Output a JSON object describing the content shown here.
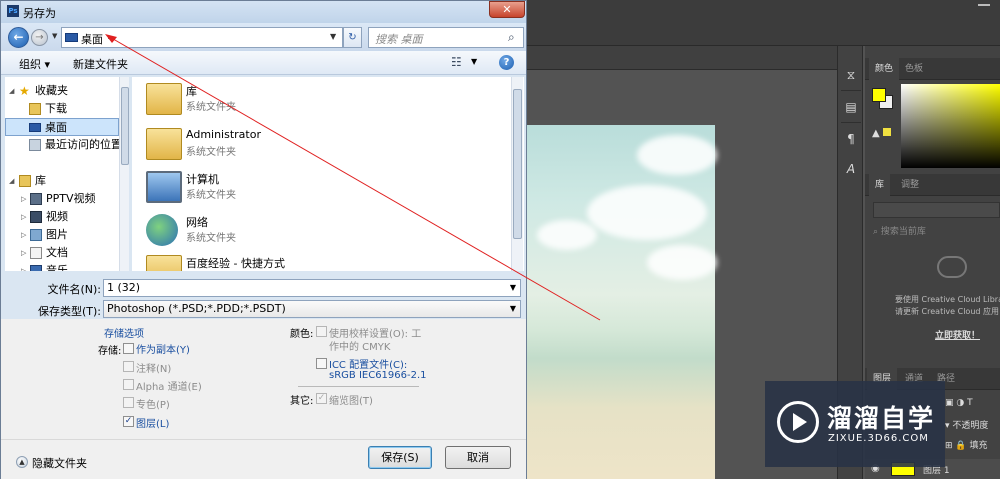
{
  "dialog": {
    "title": "另存为",
    "app_icon_label": "Ps",
    "close_label": "✕",
    "address": {
      "location": "桌面",
      "separator": "▸"
    },
    "search": {
      "placeholder": "搜索 桌面"
    },
    "toolbar": {
      "organize": "组织 ▾",
      "new_folder": "新建文件夹"
    },
    "nav": [
      {
        "label": "收藏夹",
        "icon": "star-icon",
        "expander": "◢"
      },
      {
        "label": "下载",
        "icon": "downloads-folder-icon",
        "expander": ""
      },
      {
        "label": "桌面",
        "icon": "desktop-icon",
        "expander": "",
        "selected": true
      },
      {
        "label": "最近访问的位置",
        "icon": "recent-places-icon",
        "expander": ""
      },
      {
        "label": "库",
        "icon": "library-icon",
        "expander": "◢"
      },
      {
        "label": "PPTV视频",
        "icon": "video-library-icon",
        "expander": "▷"
      },
      {
        "label": "视频",
        "icon": "video-library-icon",
        "expander": "▷"
      },
      {
        "label": "图片",
        "icon": "pictures-library-icon",
        "expander": "▷"
      },
      {
        "label": "文档",
        "icon": "documents-library-icon",
        "expander": "▷"
      },
      {
        "label": "音乐",
        "icon": "music-library-icon",
        "expander": "▷"
      }
    ],
    "files": [
      {
        "name": "库",
        "type": "系统文件夹",
        "icon": "library-folder-icon"
      },
      {
        "name": "Administrator",
        "type": "系统文件夹",
        "icon": "user-folder-icon"
      },
      {
        "name": "计算机",
        "type": "系统文件夹",
        "icon": "computer-icon"
      },
      {
        "name": "网络",
        "type": "系统文件夹",
        "icon": "network-icon"
      },
      {
        "name": "百度经验 - 快捷方式",
        "type": "",
        "icon": "folder-shortcut-icon"
      }
    ],
    "filename_label": "文件名(N):",
    "filename_value": "1 (32)",
    "filetype_label": "保存类型(T):",
    "filetype_value": "Photoshop (*.PSD;*.PDD;*.PSDT)",
    "options": {
      "title": "存储选项",
      "save_label": "存储:",
      "as_copy": "作为副本(Y)",
      "notes": "注释(N)",
      "alpha": "Alpha 通道(E)",
      "spot": "专色(P)",
      "layers": "图层(L)",
      "color_label": "颜色:",
      "proof_setup": "使用校样设置(O): 工",
      "proof_setup_2": "作中的 CMYK",
      "icc": "ICC 配置文件(C):",
      "icc_profile": "sRGB IEC61966-2.1",
      "other_label": "其它:",
      "thumbnail": "缩览图(T)"
    },
    "hide_folders": "隐藏文件夹",
    "save_button": "保存(S)",
    "cancel_button": "取消"
  },
  "photoshop": {
    "color_tabs": [
      "颜色",
      "色板"
    ],
    "library_tabs": [
      "库",
      "调整"
    ],
    "library_search": "搜索当前库",
    "cc_message_1": "要使用 Creative Cloud Libra",
    "cc_message_2": "请更新 Creative Cloud 应用",
    "cc_link": "立即获取！",
    "layer_tabs": [
      "图层",
      "通道",
      "路径"
    ],
    "opacity_label": "不透明度",
    "fill_label": "填充",
    "layer_name": "图层 1",
    "foreground_color": "#ffff00"
  },
  "watermark": {
    "brand": "溜溜自学",
    "url": "ZIXUE.3D66.COM"
  }
}
